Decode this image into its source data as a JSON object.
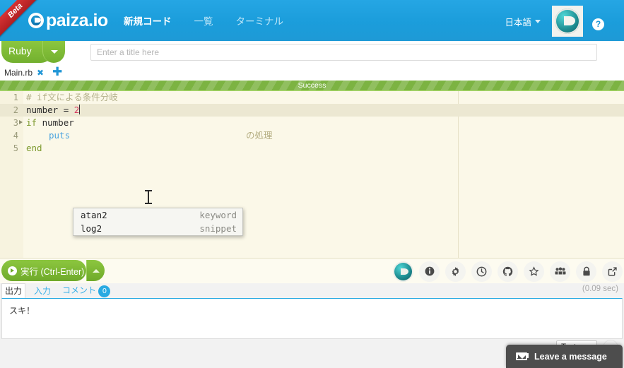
{
  "header": {
    "ribbon": "Beta",
    "logo_text": "paiza.io",
    "logo_sup": "°",
    "nav": [
      {
        "label": "新規コード",
        "active": true
      },
      {
        "label": "一覧",
        "active": false
      },
      {
        "label": "ターミナル",
        "active": false
      }
    ],
    "language": "日本語",
    "help": "?"
  },
  "toolbar": {
    "language_button": "Ruby",
    "title_placeholder": "Enter a title here",
    "title_value": "",
    "tab_name": "Main.rb",
    "tab_close": "✖",
    "tab_add": "✚"
  },
  "status": {
    "banner": "Success"
  },
  "editor": {
    "lines": [
      {
        "num": "1",
        "fold": false,
        "text": "# if文による条件分岐",
        "active": false
      },
      {
        "num": "2",
        "fold": false,
        "text": "number = 2",
        "active": true
      },
      {
        "num": "3",
        "fold": true,
        "text": "if number",
        "active": false
      },
      {
        "num": "4",
        "fold": false,
        "text": "    puts",
        "active": false
      },
      {
        "num": "5",
        "fold": false,
        "text": "end",
        "active": false
      }
    ],
    "line1_comment": "# if文による条件分岐",
    "line2_var": "number",
    "line2_eq": "=",
    "line2_num": "2",
    "line3_kw": "if",
    "line3_var": "number",
    "line4_fn": "puts",
    "line4_tail": "の処理",
    "line5_kw": "end"
  },
  "autocomplete": {
    "items": [
      {
        "label": "atan2",
        "meta": "keyword"
      },
      {
        "label": "log2",
        "meta": "snippet"
      }
    ]
  },
  "run": {
    "label": "実行 (Ctrl-Enter)",
    "icons": [
      {
        "name": "paiza-logo-icon",
        "glyph": ""
      },
      {
        "name": "info-icon",
        "glyph": "ℹ"
      },
      {
        "name": "gear-icon",
        "glyph": "⚙"
      },
      {
        "name": "clock-icon",
        "glyph": "◷"
      },
      {
        "name": "github-icon",
        "glyph": "☉"
      },
      {
        "name": "star-icon",
        "glyph": "☆"
      },
      {
        "name": "group-icon",
        "glyph": "♟"
      },
      {
        "name": "lock-icon",
        "glyph": "ὑ2"
      },
      {
        "name": "share-icon",
        "glyph": "↪"
      }
    ]
  },
  "output": {
    "tabs": [
      {
        "label": "出力",
        "active": true
      },
      {
        "label": "入力",
        "active": false
      },
      {
        "label": "コメント",
        "active": false
      }
    ],
    "comment_count": "0",
    "exec_time": "(0.09 sec)",
    "body": "スキ！",
    "format_select": "Text"
  },
  "chat": {
    "label": "Leave a message"
  },
  "colors": {
    "brand_blue": "#1e9ad6",
    "accent_green": "#8cc63f",
    "success_green": "#7cb342",
    "editor_bg": "#fbf8e8",
    "badge_blue": "#29aae2",
    "chat_dark": "#4d4d4d"
  }
}
